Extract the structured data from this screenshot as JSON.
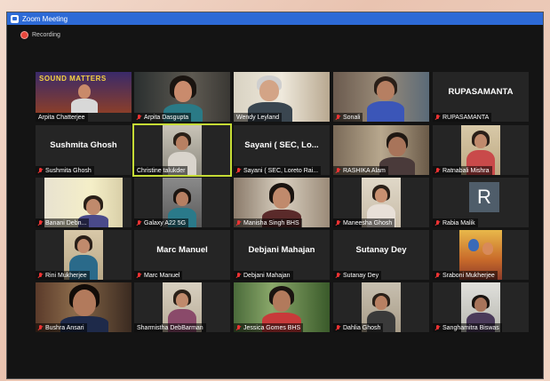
{
  "window": {
    "title": "Zoom Meeting"
  },
  "recording": {
    "label": "Recording"
  },
  "participants": [
    {
      "name": "Arpita Chatterjee",
      "muted": false,
      "poster_text": "SOUND MATTERS"
    },
    {
      "name": "Arpita Dasgupta",
      "muted": true
    },
    {
      "name": "Wendy Leyland",
      "muted": false
    },
    {
      "name": "Sonali",
      "muted": true
    },
    {
      "name": "RUPASAMANTA",
      "muted": true,
      "display_name": "RUPASAMANTA"
    },
    {
      "name": "Sushmita Ghosh",
      "muted": true,
      "display_name": "Sushmita Ghosh"
    },
    {
      "name": "Christine talukder",
      "muted": false,
      "active_speaker": true
    },
    {
      "name": "Sayani ( SEC, Loreto Rai...",
      "muted": true,
      "display_name": "Sayani ( SEC, Lo..."
    },
    {
      "name": "RASHIKA Alam",
      "muted": true
    },
    {
      "name": "Ratnabali Mishra",
      "muted": true
    },
    {
      "name": "Banani Debn...",
      "muted": true
    },
    {
      "name": "Galaxy A22 5G",
      "muted": true
    },
    {
      "name": "Manisha Singh BHS",
      "muted": true
    },
    {
      "name": "Maneesha Ghosh",
      "muted": true
    },
    {
      "name": "Rabia Malik",
      "muted": true,
      "avatar_letter": "R"
    },
    {
      "name": "Rini Mukherjee",
      "muted": true
    },
    {
      "name": "Marc Manuel",
      "muted": true,
      "display_name": "Marc Manuel"
    },
    {
      "name": "Debjani Mahajan",
      "muted": true,
      "display_name": "Debjani Mahajan"
    },
    {
      "name": "Sutanay Dey",
      "muted": true,
      "display_name": "Sutanay Dey"
    },
    {
      "name": "Sraboni Mukherjee",
      "muted": true
    },
    {
      "name": "Bushra Ansari",
      "muted": true
    },
    {
      "name": "Sharmistha DebBarman",
      "muted": false
    },
    {
      "name": "Jessica Gomes BHS",
      "muted": true
    },
    {
      "name": "Dahlia Ghosh",
      "muted": true
    },
    {
      "name": "Sanghamitra Biswas",
      "muted": true
    }
  ],
  "colors": {
    "titlebar": "#2d6ad6",
    "active_speaker": "#c6dc35",
    "muted_icon": "#e33"
  }
}
